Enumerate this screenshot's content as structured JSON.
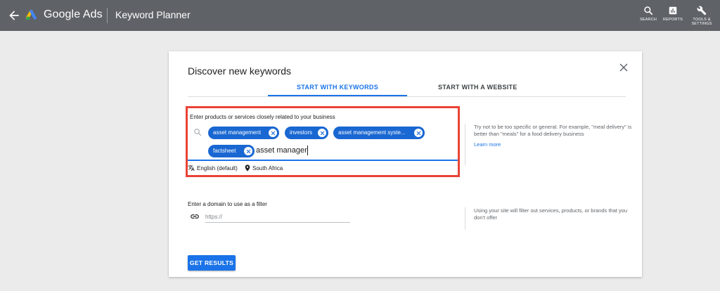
{
  "header": {
    "brand": "Google Ads",
    "page": "Keyword Planner",
    "actions": [
      {
        "label": "SEARCH",
        "icon": "search-icon"
      },
      {
        "label": "REPORTS",
        "icon": "reports-icon"
      },
      {
        "label_line1": "TOOLS &",
        "label_line2": "SETTINGS",
        "icon": "wrench-icon"
      }
    ]
  },
  "dialog": {
    "title": "Discover new keywords",
    "tabs": [
      {
        "label": "START WITH KEYWORDS",
        "active": true
      },
      {
        "label": "START WITH A WEBSITE",
        "active": false
      }
    ],
    "keywords": {
      "label": "Enter products or services closely related to your business",
      "chips": [
        "asset management",
        "investors",
        "asset management syste...",
        "factsheet"
      ],
      "input_value": "asset manager",
      "language": "English (default)",
      "location": "South Africa"
    },
    "keywords_hint": {
      "text": "Try not to be too specific or general. For example, \"meal delivery\" is better than \"meals\" for a food delivery business",
      "link": "Learn more"
    },
    "domain": {
      "label": "Enter a domain to use as a filter",
      "placeholder": "https://"
    },
    "domain_hint": "Using your site will filter out services, products, or brands that you don't offer",
    "submit_label": "GET RESULTS"
  },
  "colors": {
    "topbar": "#5f6368",
    "accent": "#1a73e8",
    "chip": "#1967d2",
    "highlight": "#ea4335"
  }
}
